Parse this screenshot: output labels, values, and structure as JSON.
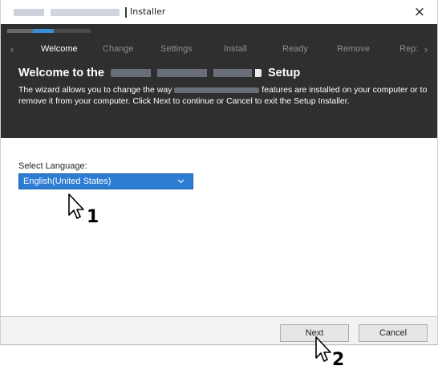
{
  "window": {
    "title": "Installer",
    "close_glyph": "×",
    "close_icon": "close-icon"
  },
  "progress": {
    "fraction": 0.56
  },
  "steps": {
    "prev_glyph": "‹",
    "next_glyph": "›",
    "items": [
      {
        "label": "Welcome",
        "active": true
      },
      {
        "label": "Change",
        "active": false
      },
      {
        "label": "Settings",
        "active": false
      },
      {
        "label": "Install",
        "active": false
      },
      {
        "label": "Ready",
        "active": false
      },
      {
        "label": "Remove",
        "active": false
      },
      {
        "label": "Rep:",
        "active": false
      }
    ]
  },
  "header": {
    "title_prefix": "Welcome to the",
    "title_suffix": "Setup",
    "desc_part1": "The wizard allows you to change the way",
    "desc_part2": "features are installed on your computer or to remove it from your computer. Click Next to continue or Cancel to exit the Setup Installer."
  },
  "language": {
    "label": "Select Language:",
    "selected": "English(United States)",
    "chevron_icon": "chevron-down-icon"
  },
  "footer": {
    "next_label": "Next",
    "cancel_label": "Cancel"
  },
  "callouts": {
    "one": "1",
    "two": "2"
  },
  "colors": {
    "header_bg": "#2f2f2f",
    "accent": "#2c7cd3",
    "progress": "#3a8ed7"
  }
}
